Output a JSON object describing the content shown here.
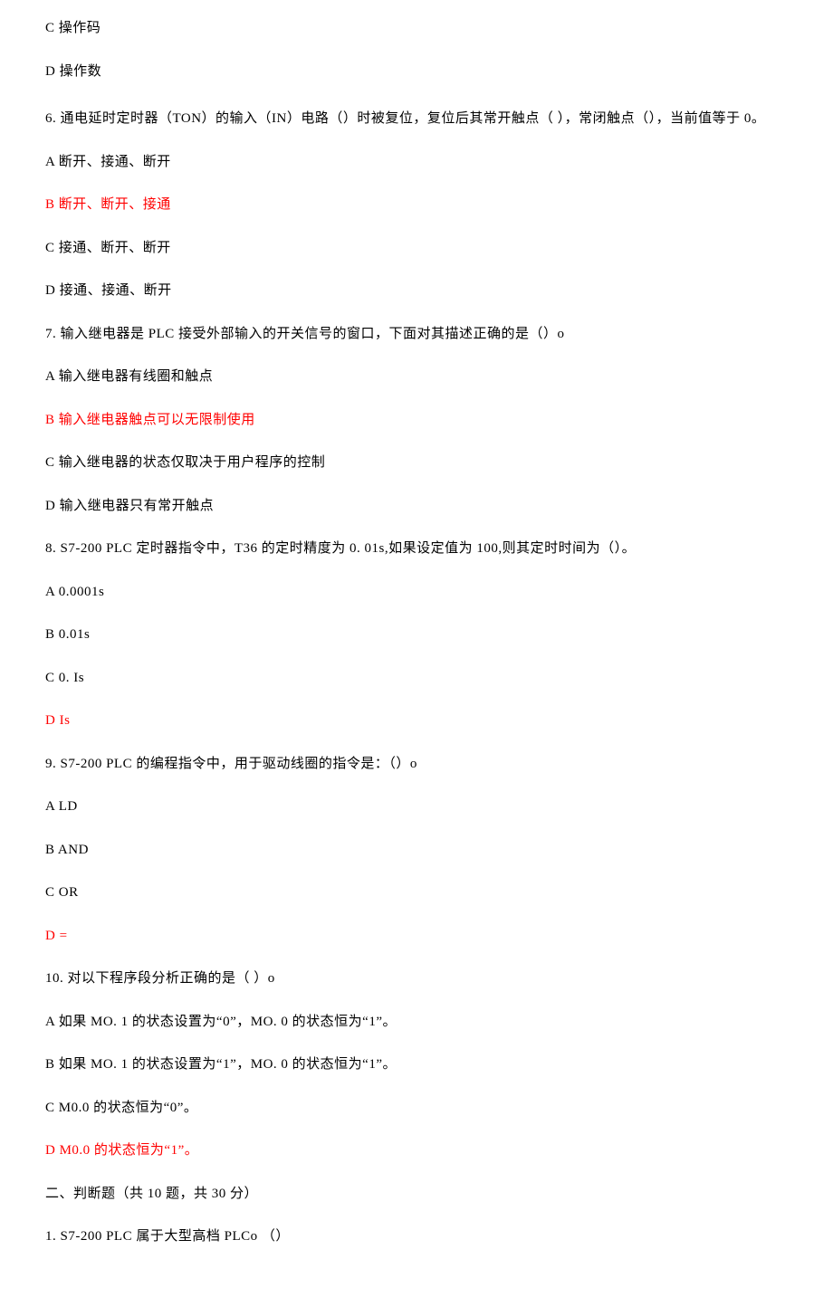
{
  "lines": [
    {
      "text": "C 操作码",
      "red": false
    },
    {
      "text": "D 操作数",
      "red": false
    },
    {
      "text": "6. 通电延时定时器（TON）的输入（IN）电路（）时被复位，复位后其常开触点（ ），常闭触点（），当前值等于 0。",
      "red": false,
      "extraTop": true
    },
    {
      "text": "A 断开、接通、断开",
      "red": false
    },
    {
      "text": "B 断开、断开、接通",
      "red": true
    },
    {
      "text": "C 接通、断开、断开",
      "red": false
    },
    {
      "text": "D 接通、接通、断开",
      "red": false
    },
    {
      "text": "7. 输入继电器是 PLC 接受外部输入的开关信号的窗口，下面对其描述正确的是（）o",
      "red": false
    },
    {
      "text": "A 输入继电器有线圈和触点",
      "red": false
    },
    {
      "text": "B 输入继电器触点可以无限制使用",
      "red": true
    },
    {
      "text": "C 输入继电器的状态仅取决于用户程序的控制",
      "red": false
    },
    {
      "text": "D 输入继电器只有常开触点",
      "red": false
    },
    {
      "text": "8. S7-200 PLC 定时器指令中，T36 的定时精度为 0. 01s,如果设定值为 100,则其定时时间为（）。",
      "red": false
    },
    {
      "text": "A 0.0001s",
      "red": false
    },
    {
      "text": "B 0.01s",
      "red": false
    },
    {
      "text": "C 0. Is",
      "red": false
    },
    {
      "text": "D Is",
      "red": true
    },
    {
      "text": "9. S7-200 PLC 的编程指令中，用于驱动线圈的指令是：（）o",
      "red": false
    },
    {
      "text": "A LD",
      "red": false
    },
    {
      "text": "B AND",
      "red": false
    },
    {
      "text": "C OR",
      "red": false
    },
    {
      "text": "D =",
      "red": true
    },
    {
      "text": "10. 对以下程序段分析正确的是（  ）o",
      "red": false
    },
    {
      "text": "A 如果 MO. 1 的状态设置为“0”，MO. 0 的状态恒为“1”。",
      "red": false
    },
    {
      "text": "B 如果 MO. 1 的状态设置为“1”，MO. 0 的状态恒为“1”。",
      "red": false
    },
    {
      "text": "C M0.0 的状态恒为“0”。",
      "red": false
    },
    {
      "text": "D M0.0 的状态恒为“1”。",
      "red": true
    },
    {
      "text": "二、判断题（共 10 题，共 30 分）",
      "red": false
    },
    {
      "text": "1. S7-200 PLC 属于大型高档 PLCo （）",
      "red": false
    }
  ]
}
